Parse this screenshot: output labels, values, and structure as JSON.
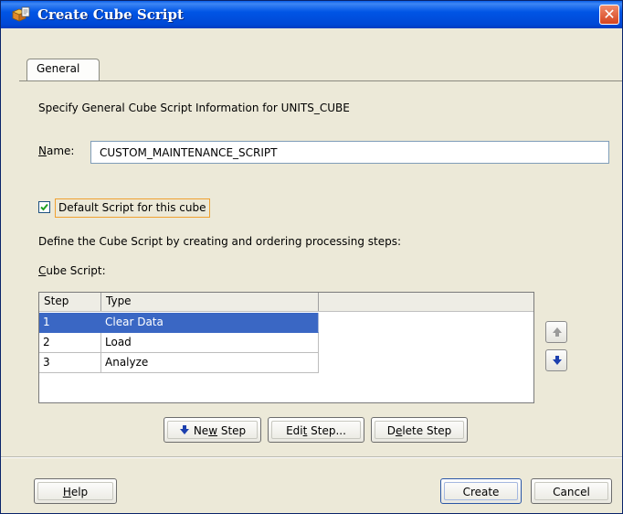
{
  "window": {
    "title": "Create Cube Script",
    "close_symbol": "✕",
    "icon": "cube-script-icon"
  },
  "tabs": [
    {
      "label": "General"
    }
  ],
  "general": {
    "description": "Specify General Cube Script Information for UNITS_CUBE",
    "name_label": "Name:",
    "name_value": "CUSTOM_MAINTENANCE_SCRIPT",
    "default_checkbox_label": "Default Script for this cube",
    "default_checked": true,
    "define_text": "Define the Cube Script by creating and ordering processing steps:",
    "cube_script_label": "Cube Script:"
  },
  "table": {
    "columns": [
      "Step",
      "Type"
    ],
    "rows": [
      {
        "step": "1",
        "type": "Clear Data",
        "selected": true
      },
      {
        "step": "2",
        "type": "Load",
        "selected": false
      },
      {
        "step": "3",
        "type": "Analyze",
        "selected": false
      }
    ]
  },
  "buttons": {
    "new_step": "New Step",
    "edit_step": "Edit Step...",
    "delete_step": "Delete Step",
    "help": "Help",
    "create": "Create",
    "cancel": "Cancel",
    "move_up": "arrow-up-icon",
    "move_down": "arrow-down-icon"
  },
  "colors": {
    "titlebar": "#0055e5",
    "selection": "#3a67c4",
    "dialog_bg": "#ece9d8",
    "checkbox_focus": "#f0a030",
    "arrow_blue": "#1c3fae"
  }
}
